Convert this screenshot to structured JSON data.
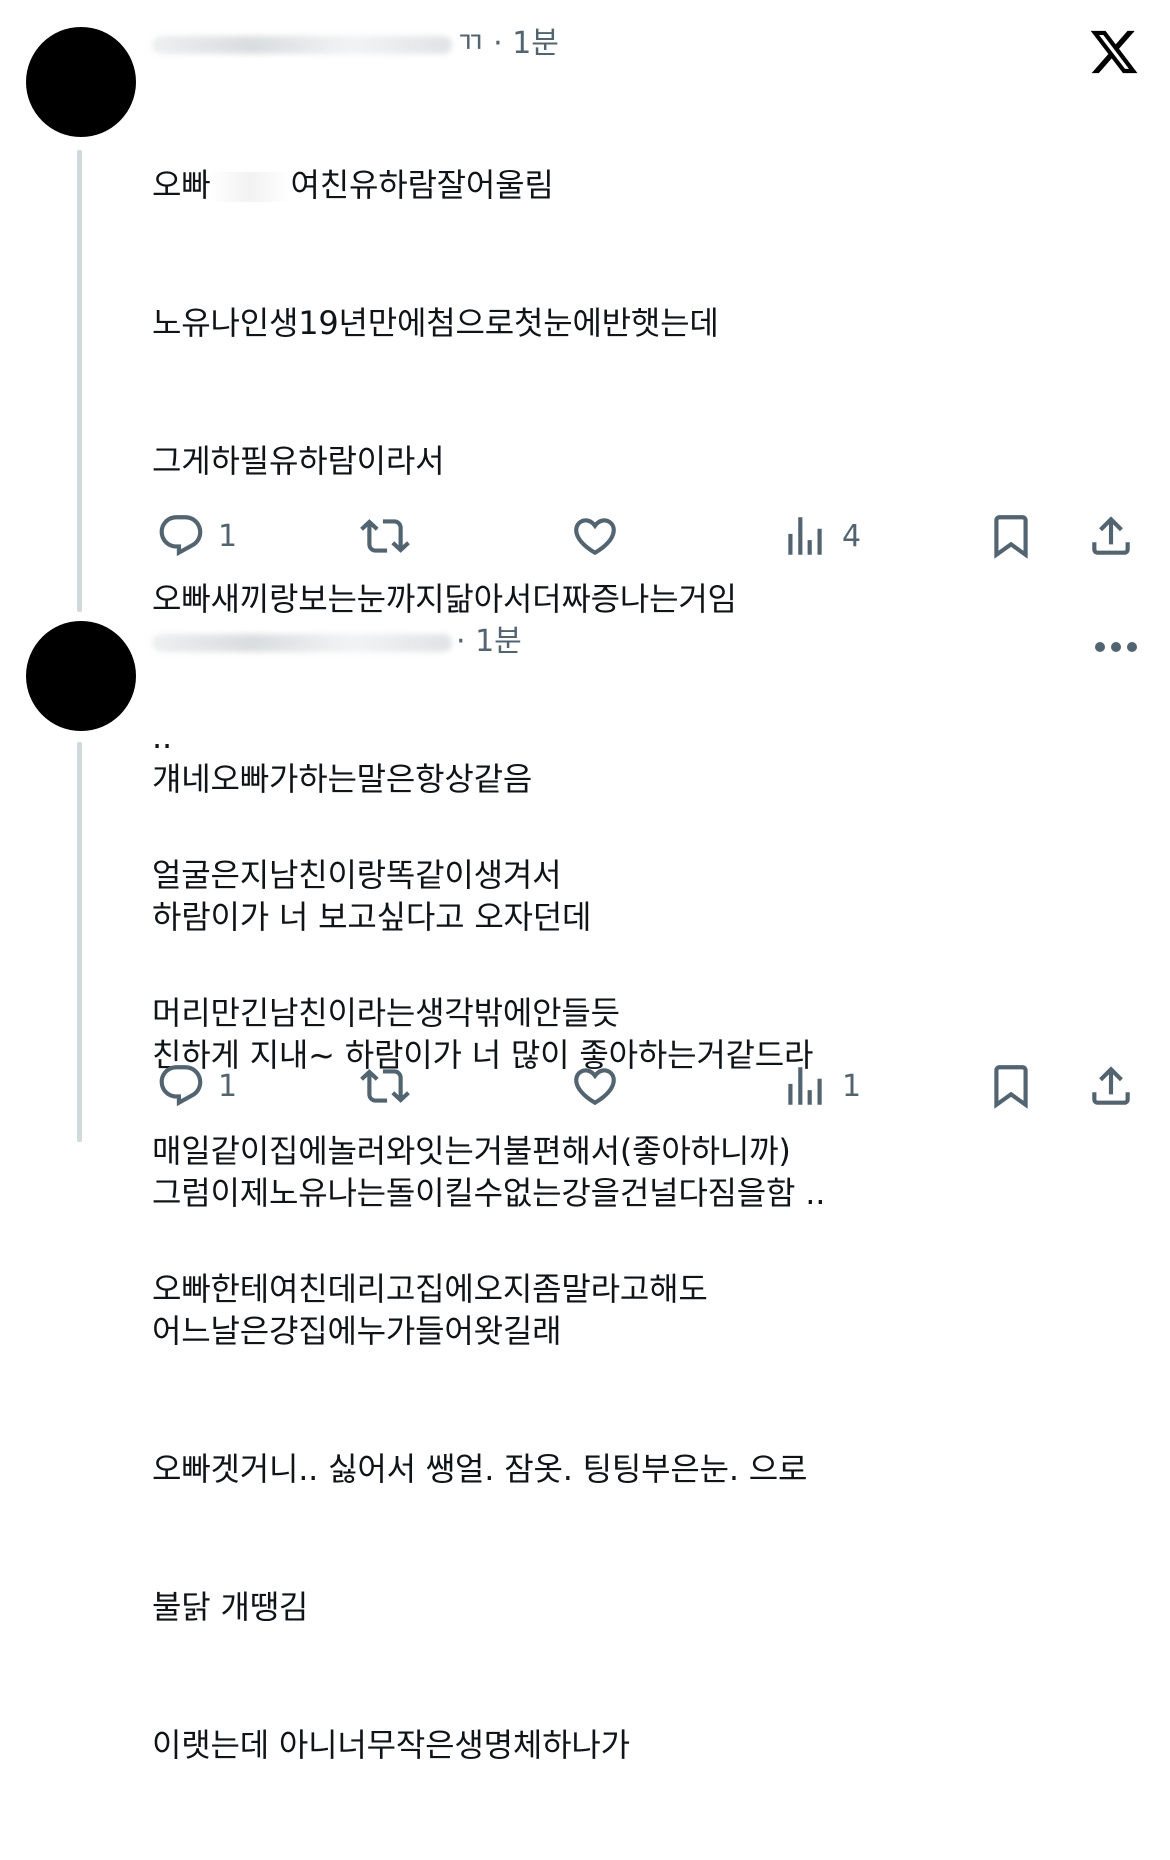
{
  "tweets": [
    {
      "meta": "ㄲ · 1분",
      "lines": [
        "오빠",
        "여친유하람잘어울림",
        "노유나인생19년만에첨으로첫눈에반햇는데",
        "그게하필유하람이라서",
        "오빠새끼랑보는눈까지닮아서더짜증나는거임",
        "..",
        "얼굴은지남친이랑똑같이생겨서",
        "머리만긴남친이라는생각밖에안들듯",
        "매일같이집에놀러와잇는거불편해서(좋아하니까)",
        "오빠한테여친데리고집에오지좀말라고해도"
      ],
      "replies": "1",
      "views": "4"
    },
    {
      "meta": "· 1분",
      "lines": [
        "걔네오빠가하는말은항상같음",
        "하람이가 너 보고싶다고 오자던데",
        "친하게 지내~ 하람이가 너 많이 좋아하는거같드라",
        "그럼이제노유나는돌이킬수없는강을건널다짐을함 ..",
        "어느날은걍집에누가들어왓길래",
        "오빠겟거니.. 싫어서 쌩얼. 잠옷. 팅팅부은눈. 으로",
        "불닭 개땡김",
        "이랫는데 아니너무작은생명체하나가"
      ],
      "replies": "1",
      "views": "1"
    }
  ],
  "icons": {
    "reply": "reply-icon",
    "retweet": "retweet-icon",
    "like": "heart-icon",
    "views": "views-icon",
    "bookmark": "bookmark-icon",
    "share": "share-icon",
    "logo": "x-logo-icon",
    "more": "more-icon"
  },
  "colors": {
    "text": "#0f1419",
    "secondary": "#536471",
    "thread_line": "#cfd9de"
  }
}
